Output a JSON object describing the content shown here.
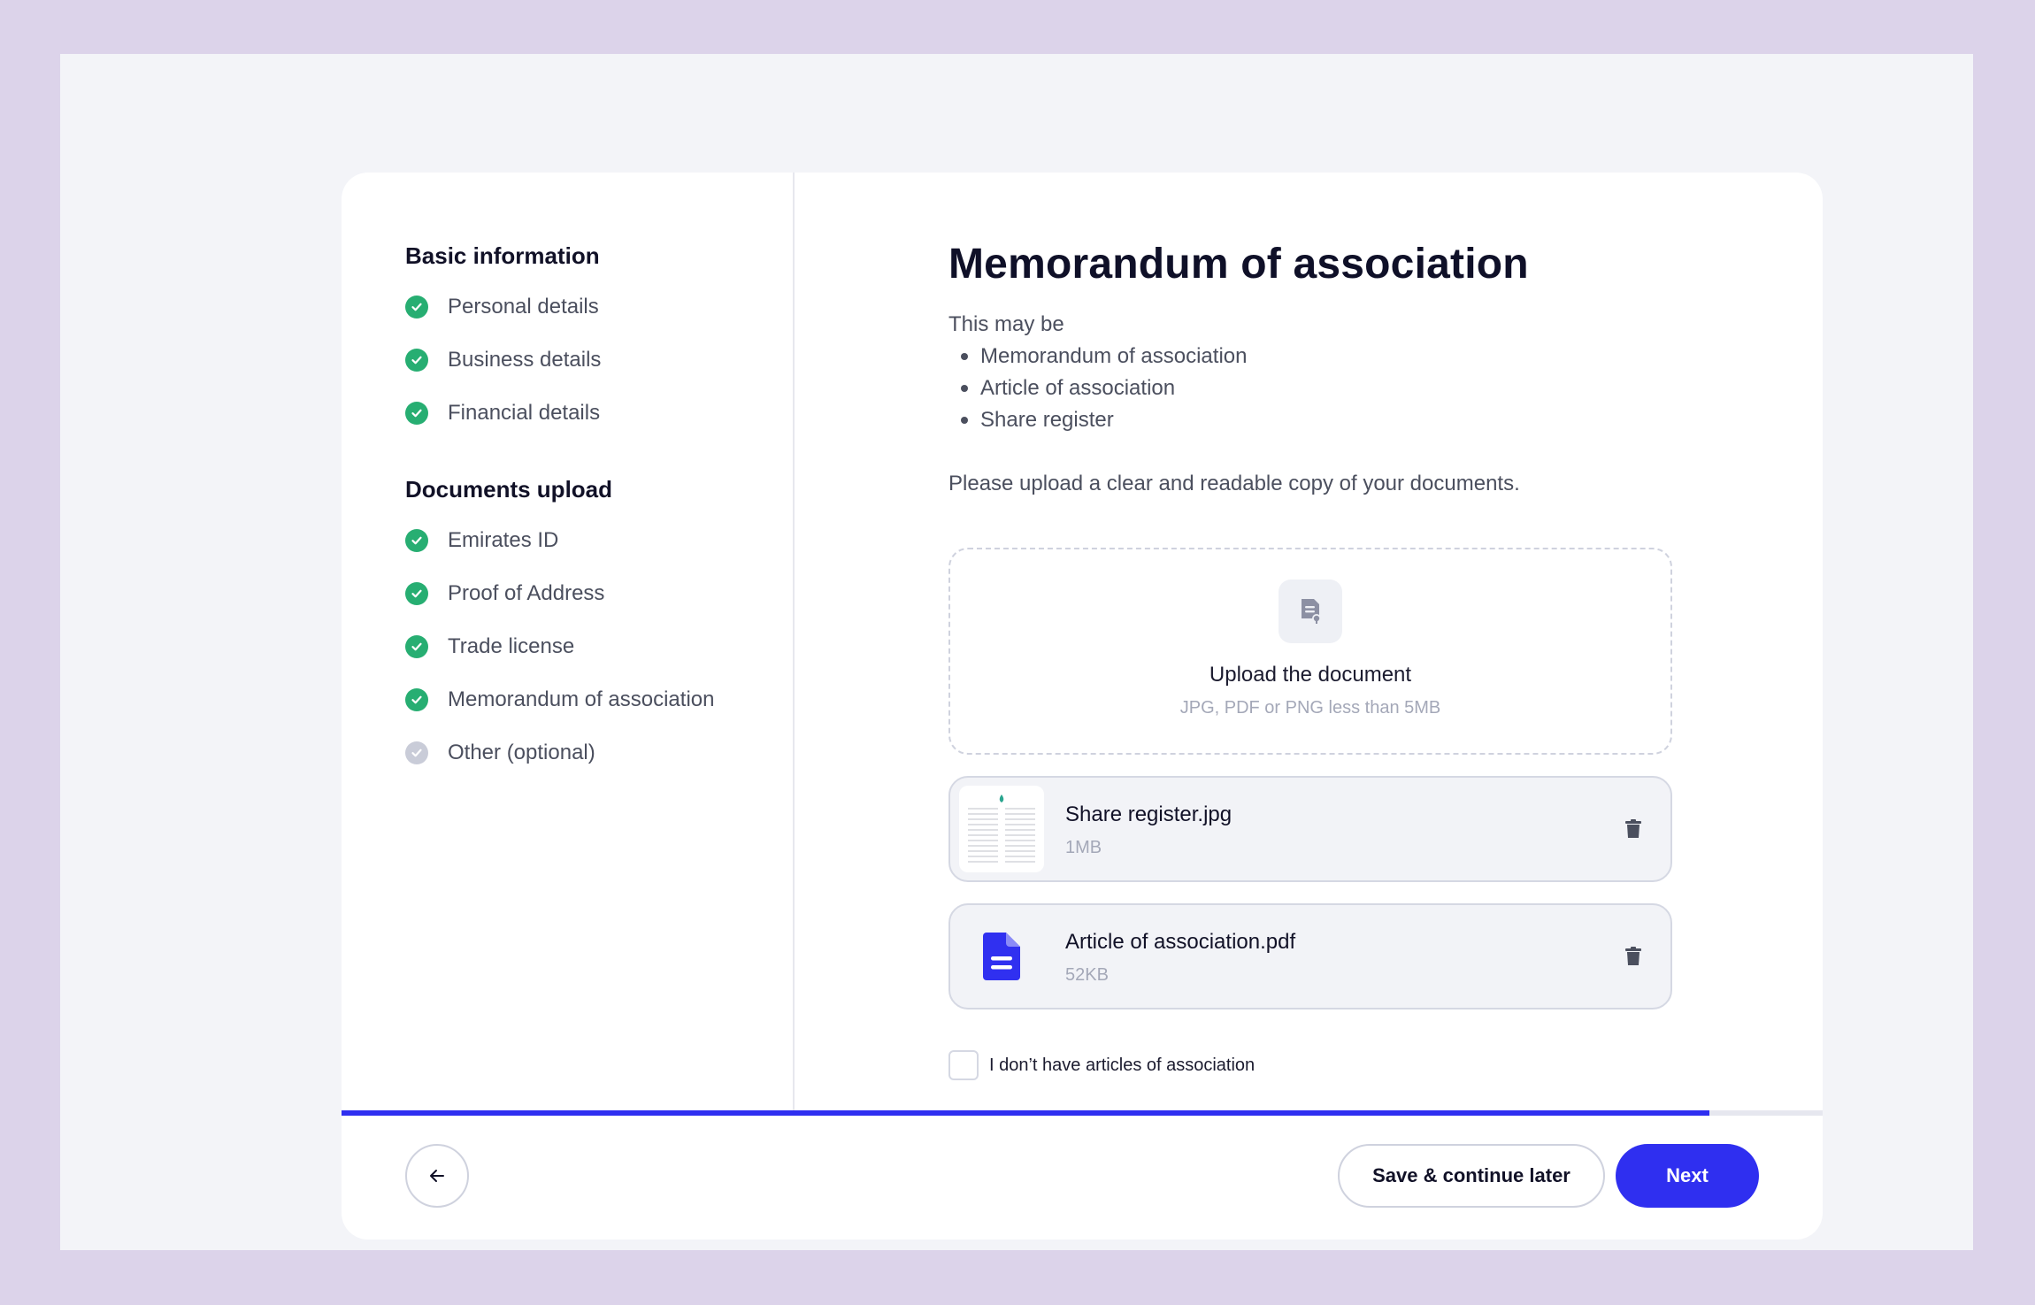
{
  "sidebar": {
    "basic_title": "Basic information",
    "basic_items": [
      {
        "label": "Personal details",
        "status": "complete"
      },
      {
        "label": "Business details",
        "status": "complete"
      },
      {
        "label": "Financial details",
        "status": "complete"
      }
    ],
    "docs_title": "Documents upload",
    "docs_items": [
      {
        "label": "Emirates ID",
        "status": "complete"
      },
      {
        "label": "Proof of Address",
        "status": "complete"
      },
      {
        "label": "Trade license",
        "status": "complete"
      },
      {
        "label": "Memorandum of association",
        "status": "complete"
      },
      {
        "label": "Other (optional)",
        "status": "pending"
      }
    ]
  },
  "main": {
    "title": "Memorandum of association",
    "intro": "This may be",
    "bullets": [
      "Memorandum of association",
      "Article of association",
      "Share register"
    ],
    "instruction": "Please upload a clear and readable copy of your documents.",
    "dropzone": {
      "title": "Upload the document",
      "hint": "JPG, PDF or PNG less than 5MB",
      "icon": "document-upload-icon"
    },
    "files": [
      {
        "name": "Share register.jpg",
        "size": "1MB",
        "thumb": "image-thumbnail"
      },
      {
        "name": "Article of association.pdf",
        "size": "52KB",
        "thumb": "pdf-file-icon"
      }
    ],
    "checkbox_label": "I don’t have articles of association",
    "checkbox_checked": false
  },
  "progress": {
    "fraction": 0.9235
  },
  "footer": {
    "save_label": "Save & continue later",
    "next_label": "Next"
  },
  "colors": {
    "accent": "#2f2ff0",
    "success": "#27ae72",
    "pending": "#c9ccd8",
    "background": "#dcd3ea"
  }
}
